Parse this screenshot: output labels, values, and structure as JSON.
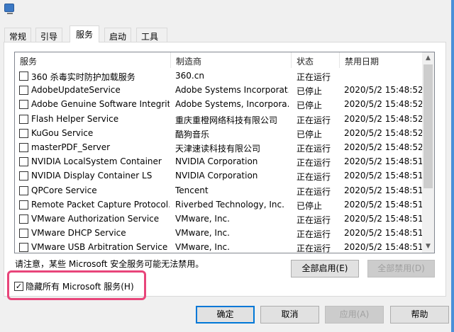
{
  "tabs": [
    "常规",
    "引导",
    "服务",
    "启动",
    "工具"
  ],
  "active_tab": "服务",
  "columns": [
    "服务",
    "制造商",
    "状态",
    "禁用日期"
  ],
  "rows": [
    {
      "service": "360 杀毒实时防护加载服务",
      "maker": "360.cn",
      "status": "正在运行",
      "date": ""
    },
    {
      "service": "AdobeUpdateService",
      "maker": "Adobe Systems Incorporat...",
      "status": "已停止",
      "date": "2020/5/2 15:48:52"
    },
    {
      "service": "Adobe Genuine Software Integrit...",
      "maker": "Adobe Systems, Incorpora...",
      "status": "已停止",
      "date": "2020/5/2 15:48:52"
    },
    {
      "service": "Flash Helper Service",
      "maker": "重庆重橙网络科技有限公司",
      "status": "正在运行",
      "date": "2020/5/2 15:48:52"
    },
    {
      "service": "KuGou Service",
      "maker": "酷狗音乐",
      "status": "已停止",
      "date": "2020/5/2 15:48:52"
    },
    {
      "service": "masterPDF_Server",
      "maker": "天津速读科技有限公司",
      "status": "正在运行",
      "date": "2020/5/2 15:48:52"
    },
    {
      "service": "NVIDIA LocalSystem Container",
      "maker": "NVIDIA Corporation",
      "status": "正在运行",
      "date": "2020/5/2 15:48:51"
    },
    {
      "service": "NVIDIA Display Container LS",
      "maker": "NVIDIA Corporation",
      "status": "正在运行",
      "date": "2020/5/2 15:48:51"
    },
    {
      "service": "QPCore Service",
      "maker": "Tencent",
      "status": "正在运行",
      "date": "2020/5/2 15:48:51"
    },
    {
      "service": "Remote Packet Capture Protocol...",
      "maker": "Riverbed Technology, Inc.",
      "status": "已停止",
      "date": "2020/5/2 15:48:51"
    },
    {
      "service": "VMware Authorization Service",
      "maker": "VMware, Inc.",
      "status": "正在运行",
      "date": "2020/5/2 15:48:51"
    },
    {
      "service": "VMware DHCP Service",
      "maker": "VMware, Inc.",
      "status": "正在运行",
      "date": "2020/5/2 15:48:51"
    },
    {
      "service": "VMware USB Arbitration Service",
      "maker": "VMware, Inc.",
      "status": "正在运行",
      "date": "2020/5/2 15:48:51"
    }
  ],
  "note": "请注意，某些 Microsoft 安全服务可能无法禁用。",
  "enable_all": "全部启用(E)",
  "disable_all": "全部禁用(D)",
  "hide_ms": "隐藏所有 Microsoft 服务(H)",
  "hide_ms_checked": true,
  "check_mark": "✓",
  "ok": "确定",
  "cancel": "取消",
  "apply": "应用(A)",
  "help": "帮助",
  "highlight_color": "#e8457a"
}
